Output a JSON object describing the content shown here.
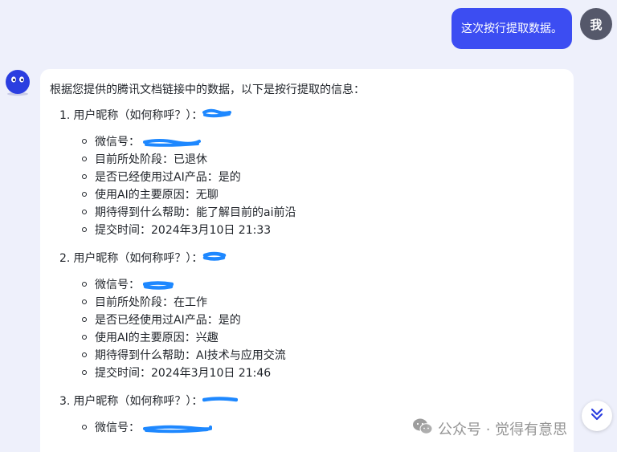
{
  "colors": {
    "page_background": "#eef0fb",
    "user_bubble": "#3c4df2",
    "bot_avatar": "#2b3ee0",
    "redaction_marker": "#1e88ff"
  },
  "user_message": {
    "text": "这次按行提取数据。",
    "avatar_label": "我"
  },
  "bot_message": {
    "avatar_icon": "robot-face-icon",
    "intro": "根据您提供的腾讯文档链接中的数据，以下是按行提取的信息：",
    "entries": [
      {
        "number": "1.",
        "label": "用户昵称（如何称呼？）：",
        "fields": [
          "微信号：",
          "目前所处阶段：已退休",
          "是否已经使用过AI产品：是的",
          "使用AI的主要原因：无聊",
          "期待得到什么帮助：能了解目前的ai前沿",
          "提交时间：2024年3月10日 21:33"
        ]
      },
      {
        "number": "2.",
        "label": "用户昵称（如何称呼？）：",
        "fields": [
          "微信号：",
          "目前所处阶段：在工作",
          "是否已经使用过AI产品：是的",
          "使用AI的主要原因：兴趣",
          "期待得到什么帮助：AI技术与应用交流",
          "提交时间：2024年3月10日 21:46"
        ]
      },
      {
        "number": "3.",
        "label": "用户昵称（如何称呼？）：",
        "fields": [
          "微信号："
        ]
      }
    ]
  },
  "scroll_button": {
    "icon": "double-chevron-down-icon"
  },
  "watermark": {
    "icon": "wechat-icon",
    "text": "公众号 · 觉得有意思"
  }
}
